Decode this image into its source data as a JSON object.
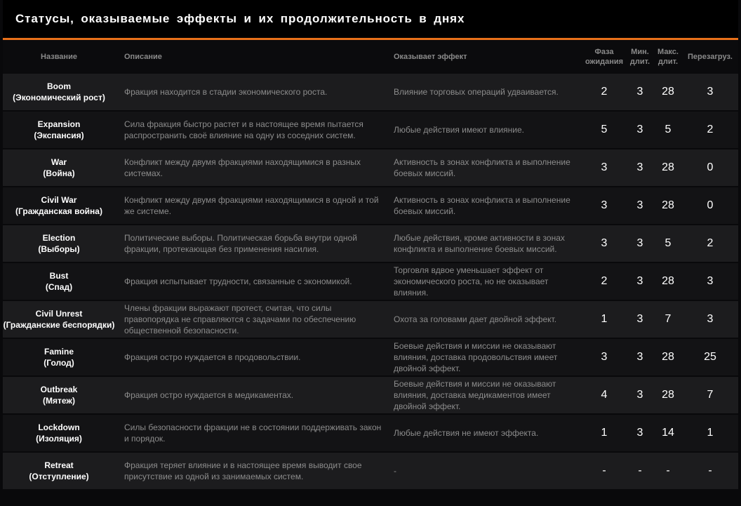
{
  "title": "Статусы,  оказываемые  эффекты  и  их  продолжительность  в  днях",
  "columns": {
    "name": "Название",
    "description": "Описание",
    "effect": "Оказывает эффект",
    "wait": "Фаза ожидания",
    "min": "Мин. длит.",
    "max": "Макс. длит.",
    "overload": "Перезагруз."
  },
  "rows": [
    {
      "name_en": "Boom",
      "name_ru": "(Экономический рост)",
      "description": "Фракция находится в стадии экономического роста.",
      "effect": "Влияние торговых операций удваивается.",
      "wait": "2",
      "min": "3",
      "max": "28",
      "overload": "3"
    },
    {
      "name_en": "Expansion",
      "name_ru": "(Экспансия)",
      "description": "Сила фракция быстро растет и в настоящее время пытается распространить своё влияние на одну из соседних систем.",
      "effect": "Любые действия имеют влияние.",
      "wait": "5",
      "min": "3",
      "max": "5",
      "overload": "2"
    },
    {
      "name_en": "War",
      "name_ru": "(Война)",
      "description": "Конфликт между двумя фракциями находящимися в разных системах.",
      "effect": "Активность в зонах конфликта и выполнение боевых миссий.",
      "wait": "3",
      "min": "3",
      "max": "28",
      "overload": "0"
    },
    {
      "name_en": "Civil War",
      "name_ru": "(Гражданская война)",
      "description": "Конфликт между двумя фракциями находящимися в одной и той же системе.",
      "effect": "Активность в зонах конфликта и выполнение боевых миссий.",
      "wait": "3",
      "min": "3",
      "max": "28",
      "overload": "0"
    },
    {
      "name_en": "Election",
      "name_ru": "(Выборы)",
      "description": "Политические выборы. Политическая борьба внутри одной фракции, протекающая без применения насилия.",
      "effect": "Любые действия, кроме активности в зонах конфликта и выполнение боевых миссий.",
      "wait": "3",
      "min": "3",
      "max": "5",
      "overload": "2"
    },
    {
      "name_en": "Bust",
      "name_ru": "(Спад)",
      "description": "Фракция испытывает трудности, связанные с экономикой.",
      "effect": "Торговля вдвое уменьшает эффект от экономического роста, но не оказывает влияния.",
      "wait": "2",
      "min": "3",
      "max": "28",
      "overload": "3"
    },
    {
      "name_en": "Civil Unrest",
      "name_ru": "(Гражданские беспорядки)",
      "description": "Члены фракции выражают протест, считая, что силы правопорядка не справляются с задачами по обеспечению общественной безопасности.",
      "effect": "Охота за головами дает двойной эффект.",
      "wait": "1",
      "min": "3",
      "max": "7",
      "overload": "3"
    },
    {
      "name_en": "Famine",
      "name_ru": "(Голод)",
      "description": "Фракция остро нуждается в продовольствии.",
      "effect": "Боевые действия и миссии не оказывают влияния, доставка продовольствия имеет двойной эффект.",
      "wait": "3",
      "min": "3",
      "max": "28",
      "overload": "25"
    },
    {
      "name_en": "Outbreak",
      "name_ru": "(Мятеж)",
      "description": "Фракция остро нуждается в медикаментах.",
      "effect": "Боевые действия и миссии не оказывают влияния, доставка медикаментов имеет двойной эффект.",
      "wait": "4",
      "min": "3",
      "max": "28",
      "overload": "7"
    },
    {
      "name_en": "Lockdown",
      "name_ru": "(Изоляция)",
      "description": "Силы безопасности фракции не в состоянии поддерживать закон и порядок.",
      "effect": "Любые действия не имеют эффекта.",
      "wait": "1",
      "min": "3",
      "max": "14",
      "overload": "1"
    },
    {
      "name_en": "Retreat",
      "name_ru": "(Отступление)",
      "description": "Фракция теряет влияние и в настоящее время выводит свое присутствие из одной из занимаемых систем.",
      "effect": "-",
      "wait": "-",
      "min": "-",
      "max": "-",
      "overload": "-"
    }
  ]
}
